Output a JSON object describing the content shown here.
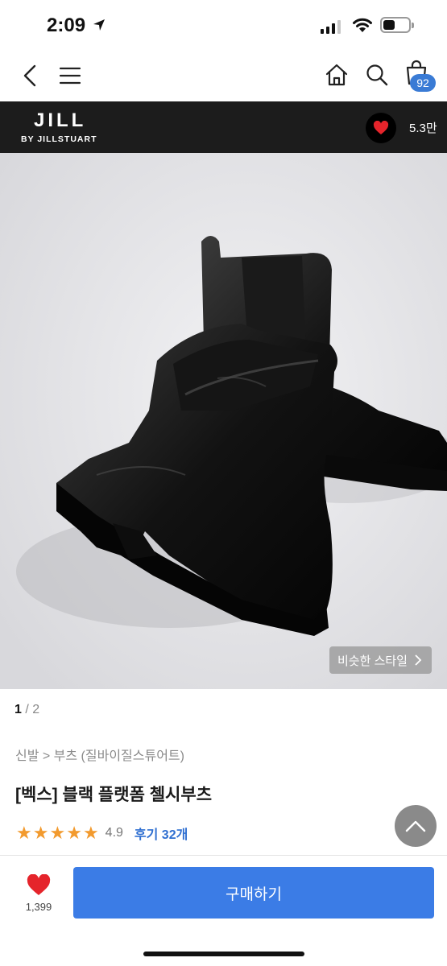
{
  "status_bar": {
    "time": "2:09",
    "battery_level": 0.45
  },
  "nav": {
    "icons": [
      "back-icon",
      "menu-icon",
      "home-icon",
      "search-icon",
      "shopping-bag-icon"
    ],
    "bag_count": "92"
  },
  "brand": {
    "name": "JILL",
    "sub": "BY JILLSTUART",
    "likes": "5.3만"
  },
  "image": {
    "similar_label": "비슷한 스타일"
  },
  "pager": {
    "current": "1",
    "rest": " / 2"
  },
  "product": {
    "breadcrumb": "신발 > 부츠 (질바이질스튜어트)",
    "title": "[벡스] 블랙 플랫폼 첼시부츠",
    "rating": 4.9,
    "rating_text": "4.9",
    "stars": 5,
    "review_link": "후기 32개"
  },
  "bottom": {
    "wish_count": "1,399",
    "buy_label": "구매하기"
  },
  "colors": {
    "accent": "#3b7ce6",
    "star": "#f29a2e",
    "heart": "#e5242b",
    "brand_bar": "#1c1c1c"
  }
}
